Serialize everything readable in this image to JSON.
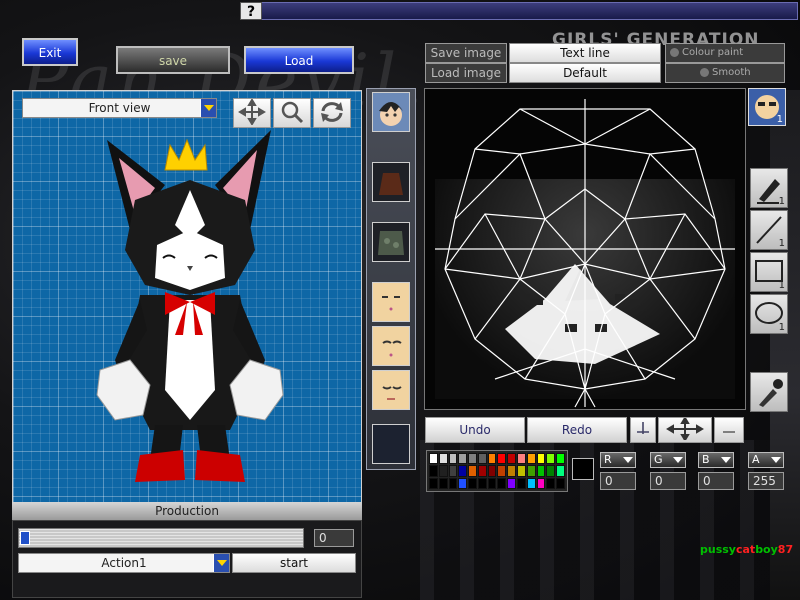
{
  "top": {
    "help_label": "?",
    "exit_label": "Exit",
    "save_label": "save",
    "load_label": "Load"
  },
  "background": {
    "title_text": "Pan Devil...",
    "brand_text": "GIRLS' GENERATION"
  },
  "viewer": {
    "view_select": "Front view",
    "tools": [
      "move-icon",
      "zoom-icon",
      "rotate-icon"
    ]
  },
  "production": {
    "header": "Production",
    "frame_value": "0",
    "action_select": "Action1",
    "start_label": "start"
  },
  "parts": {
    "items": [
      "hair-part",
      "body-part",
      "armor-part",
      "face-part-1",
      "face-part-2",
      "face-part-3",
      "empty-part"
    ]
  },
  "texture_header": {
    "save_image": "Save image",
    "load_image": "Load image",
    "text_line": "Text line",
    "default": "Default",
    "colour_paint": "Colour paint",
    "smooth": "Smooth"
  },
  "texture_tools": {
    "undo": "Undo",
    "redo": "Redo",
    "face_count": "1",
    "pen_count": "1",
    "line_count": "1",
    "rect_count": "1",
    "ellipse_count": "1"
  },
  "color": {
    "r_value": "0",
    "g_value": "0",
    "b_value": "0",
    "a_value": "255",
    "palette": [
      "#ffffff",
      "#e0e0e0",
      "#c0c0c0",
      "#a0a0a0",
      "#808080",
      "#606060",
      "#ff8000",
      "#ff0000",
      "#c00000",
      "#ff8080",
      "#ffa000",
      "#ffff00",
      "#80ff00",
      "#00ff00",
      "#000000",
      "#202020",
      "#404040",
      "#0000a0",
      "#e06000",
      "#a00000",
      "#800000",
      "#c04000",
      "#c08000",
      "#c0c000",
      "#40a000",
      "#00c000",
      "#008000",
      "#00ff80",
      "#000000",
      "#000000",
      "#000000",
      "#2050ff",
      "#000000",
      "#000000",
      "#000000",
      "#000000",
      "#8000ff",
      "#000000",
      "#00c0ff",
      "#ff00c0",
      "#000000",
      "#000000"
    ]
  },
  "signature": {
    "part1": "pussy",
    "part2": "cat",
    "part3": "boy",
    "part4": "87",
    "colors": [
      "#00c000",
      "#ff2020",
      "#00c000",
      "#ff2020"
    ]
  }
}
